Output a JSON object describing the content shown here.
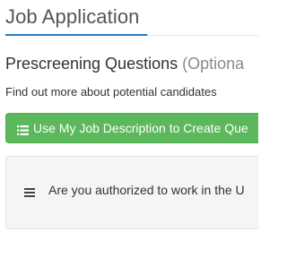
{
  "header": {
    "title": "Job Application"
  },
  "prescreening": {
    "heading": "Prescreening Questions",
    "optional_label": "(Optiona",
    "helper_text": "Find out more about potential candidates",
    "create_button_label": "Use My Job Description to Create Que",
    "questions": [
      {
        "text": "Are you authorized to work in the U"
      }
    ]
  },
  "icons": {
    "create_button_icon": "list-icon",
    "question_handle_icon": "drag-handle-icon"
  },
  "colors": {
    "title_underline": "#2b7bbd",
    "button_green": "#5cb85c",
    "panel_background": "#f5f5f5"
  }
}
